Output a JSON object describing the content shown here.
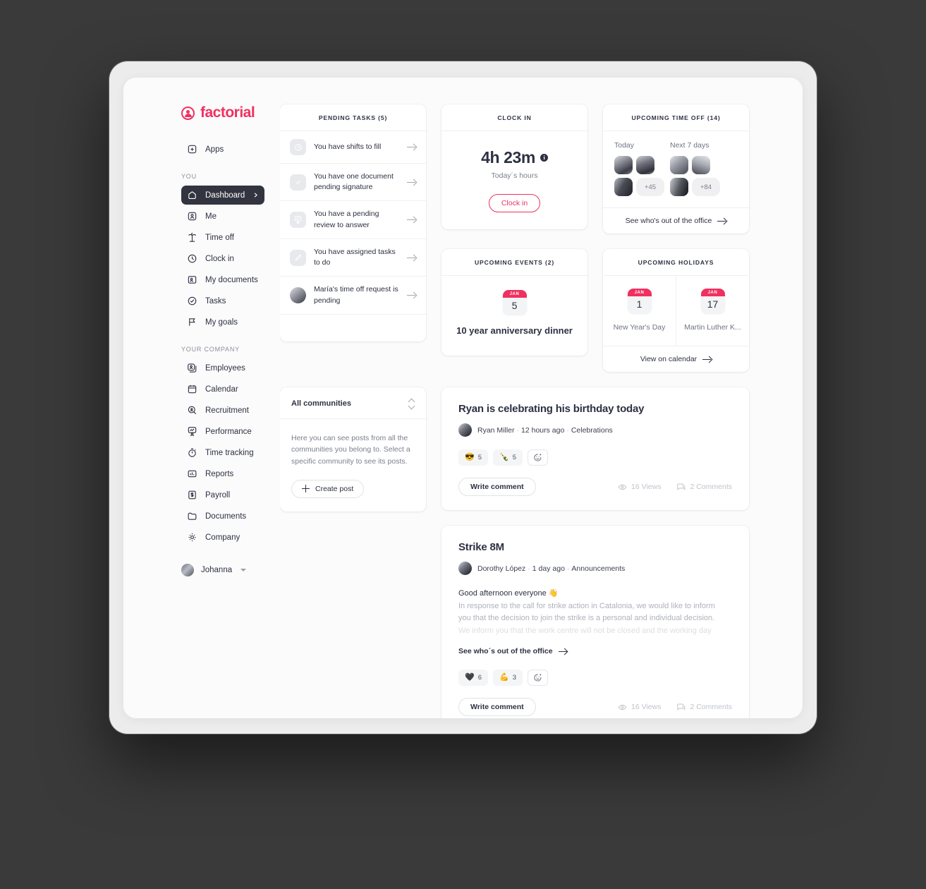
{
  "brand": {
    "name": "factorial",
    "mark": "factorial-logo-icon"
  },
  "sidebar": {
    "apps_label": "Apps",
    "sections": [
      {
        "label": "YOU",
        "items": [
          {
            "label": "Dashboard",
            "icon": "home-icon",
            "active": true
          },
          {
            "label": "Me",
            "icon": "user-square-icon",
            "active": false
          },
          {
            "label": "Time off",
            "icon": "palm-tree-icon",
            "active": false
          },
          {
            "label": "Clock in",
            "icon": "clock-icon",
            "active": false
          },
          {
            "label": "My documents",
            "icon": "document-user-icon",
            "active": false
          },
          {
            "label": "Tasks",
            "icon": "check-circle-icon",
            "active": false
          },
          {
            "label": "My goals",
            "icon": "flag-icon",
            "active": false
          }
        ]
      },
      {
        "label": "YOUR COMPANY",
        "items": [
          {
            "label": "Employees",
            "icon": "employees-icon",
            "active": false
          },
          {
            "label": "Calendar",
            "icon": "calendar-icon",
            "active": false
          },
          {
            "label": "Recruitment",
            "icon": "magnifier-user-icon",
            "active": false
          },
          {
            "label": "Performance",
            "icon": "performance-icon",
            "active": false
          },
          {
            "label": "Time tracking",
            "icon": "stopwatch-icon",
            "active": false
          },
          {
            "label": "Reports",
            "icon": "bar-chart-icon",
            "active": false
          },
          {
            "label": "Payroll",
            "icon": "money-bill-icon",
            "active": false
          },
          {
            "label": "Documents",
            "icon": "folder-icon",
            "active": false
          },
          {
            "label": "Company",
            "icon": "gear-icon",
            "active": false
          }
        ]
      }
    ],
    "user": {
      "name": "Johanna"
    }
  },
  "clock_in_card": {
    "title": "CLOCK IN",
    "time": "4h 23m",
    "subtitle": "Today´s hours",
    "button": "Clock in"
  },
  "time_off_card": {
    "title": "UPCOMING TIME OFF (14)",
    "columns": [
      {
        "label": "Today",
        "more": "+45"
      },
      {
        "label": "Next 7 days",
        "more": "+84"
      }
    ],
    "footer": "See who's out of the office"
  },
  "pending_tasks_card": {
    "title": "PENDING TASKS (5)",
    "items": [
      {
        "text": "You have shifts to fill",
        "icon": "clock-icon"
      },
      {
        "text": "You have one document pending signature",
        "icon": "check-icon"
      },
      {
        "text": "You have a pending review to answer",
        "icon": "review-icon"
      },
      {
        "text": "You have assigned tasks to do",
        "icon": "pencil-icon"
      },
      {
        "text": "María's time off request is pending",
        "icon": "avatar-photo"
      }
    ]
  },
  "events_card": {
    "title": "UPCOMING EVENTS (2)",
    "month": "JAN",
    "day": "5",
    "event": "10 year anniversary dinner"
  },
  "holidays_card": {
    "title": "UPCOMING HOLIDAYS",
    "items": [
      {
        "month": "JAN",
        "day": "1",
        "name": "New Year's Day"
      },
      {
        "month": "JAN",
        "day": "17",
        "name": "Martin Luther K..."
      }
    ],
    "footer": "View on calendar"
  },
  "communities_card": {
    "selected": "All communities",
    "description": "Here you can see posts from all the communities you belong to. Select a specific community to see its posts.",
    "create_post": "Create post"
  },
  "posts": [
    {
      "title": "Ryan is celebrating his birthday today",
      "author": "Ryan Miller",
      "time": "12 hours ago",
      "category": "Celebrations",
      "body_lines": [],
      "link": null,
      "reactions": [
        {
          "emoji": "😎",
          "count": "5"
        },
        {
          "emoji": "🍾",
          "count": "5"
        }
      ],
      "write_comment": "Write comment",
      "views": "16 Views",
      "comments": "2 Comments"
    },
    {
      "title": "Strike 8M",
      "author": "Dorothy López",
      "time": "1 day ago",
      "category": "Announcements",
      "body_lines": [
        "Good afternoon everyone 👋",
        "In response to the call for strike action in Catalonia, we would like to inform",
        "you that the decision to join the strike is a personal and individual decision.",
        "We inform you that the work centre will not be closed and the working day"
      ],
      "link": "See who´s out of the office",
      "reactions": [
        {
          "emoji": "🖤",
          "count": "6"
        },
        {
          "emoji": "💪",
          "count": "3"
        }
      ],
      "write_comment": "Write comment",
      "views": "16 Views",
      "comments": "2 Comments"
    }
  ],
  "colors": {
    "accent": "#f03060",
    "sidebar_active_bg": "#32343f",
    "text_primary": "#2d3142",
    "text_muted": "#7b808d",
    "page_bg": "#fbfbfb"
  }
}
